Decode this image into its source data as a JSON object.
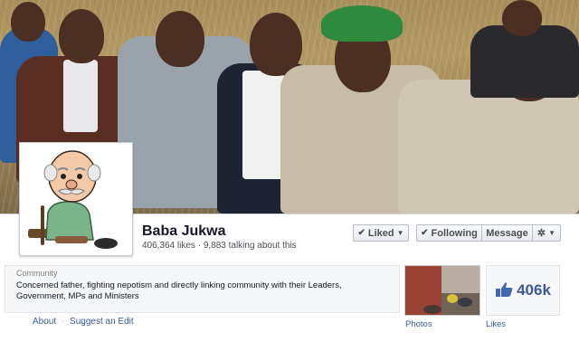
{
  "page": {
    "name": "Baba Jukwa",
    "stats": "406,364 likes · 9,883 talking about this"
  },
  "actions": {
    "liked": "Liked",
    "following": "Following",
    "message": "Message"
  },
  "about": {
    "category": "Community",
    "description": "Concerned father, fighting nepotism and directly linking community with their Leaders, Government, MPs and Ministers",
    "link_about": "About",
    "separator": "·",
    "link_suggest": "Suggest an Edit"
  },
  "apps": {
    "photos_label": "Photos",
    "likes_count": "406k",
    "likes_label": "Likes"
  },
  "colors": {
    "link": "#3b5998",
    "hat": "#2e8b3e"
  },
  "icons": {
    "check": "check-icon",
    "caret": "caret-down-icon",
    "gear": "gear-icon",
    "thumb": "thumbs-up-icon"
  }
}
